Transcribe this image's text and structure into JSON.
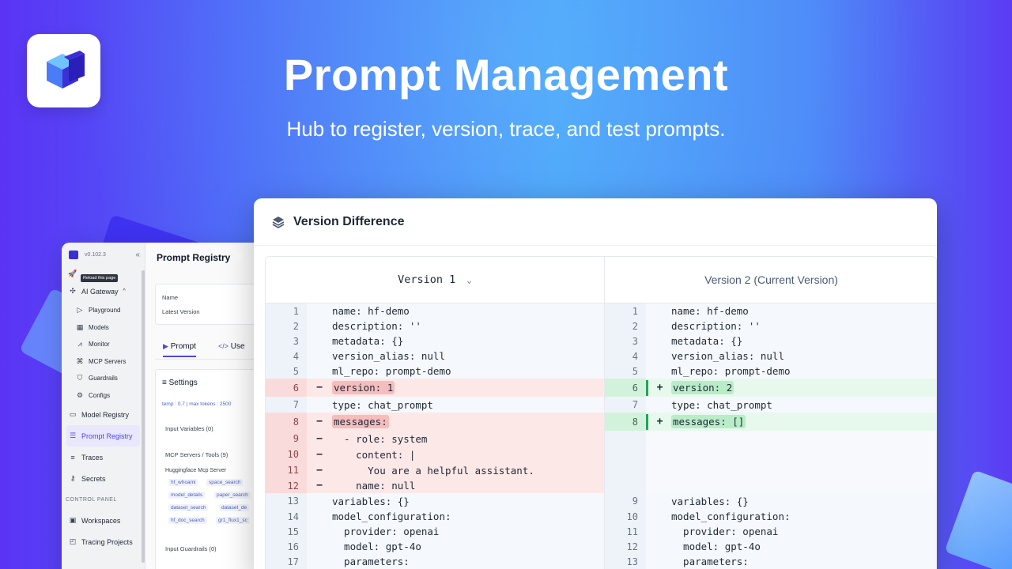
{
  "hero": {
    "title": "Prompt Management",
    "subtitle": "Hub to register, version, trace, and test prompts."
  },
  "colors": {
    "accent": "#4f46e5",
    "add": "#22a35a",
    "del": "#f7bcbc"
  },
  "back_window": {
    "version": "v0.102.3",
    "tooltip": "Reload this page",
    "sidebar": {
      "items": [
        {
          "label": "AI Gateway",
          "icon": "gateway-icon"
        },
        {
          "label": "Playground",
          "icon": "play-icon"
        },
        {
          "label": "Models",
          "icon": "grid-icon"
        },
        {
          "label": "Monitor",
          "icon": "chart-icon"
        },
        {
          "label": "MCP Servers",
          "icon": "mcp-icon"
        },
        {
          "label": "Guardrails",
          "icon": "shield-icon"
        },
        {
          "label": "Configs",
          "icon": "gear-icon"
        },
        {
          "label": "Model Registry",
          "icon": "registry-icon"
        },
        {
          "label": "Prompt Registry",
          "icon": "prompt-icon"
        },
        {
          "label": "Traces",
          "icon": "traces-icon"
        },
        {
          "label": "Secrets",
          "icon": "key-icon"
        },
        {
          "label": "Workspaces",
          "icon": "workspace-icon"
        },
        {
          "label": "Tracing Projects",
          "icon": "tracing-icon"
        }
      ],
      "section_label": "CONTROL PANEL"
    },
    "panel": {
      "title": "Prompt Registry",
      "name_label": "Name",
      "latest_label": "Latest Version",
      "tab_prompt": "Prompt",
      "tab_use": "Use",
      "settings": "Settings",
      "settings_meta": "temp : 0.7 | max tokens : 2500",
      "input_variables": "Input Variables (0)",
      "mcp_label": "MCP Servers / Tools (9)",
      "mcp_server": "Huggingface Mcp Server",
      "tools": [
        "hf_whoami",
        "space_search",
        "model_details",
        "paper_search",
        "dataset_search",
        "dataset_de",
        "hf_doc_search",
        "gr1_flux1_sc"
      ],
      "input_guardrails": "Input Guardrails (0)"
    }
  },
  "main_window": {
    "title": "Version Difference",
    "left_header": "Version 1",
    "right_header": "Version 2 (Current Version)",
    "left_rows": [
      {
        "n": "1",
        "text": "name: hf-demo",
        "type": "ctx"
      },
      {
        "n": "2",
        "text": "description: ''",
        "type": "ctx"
      },
      {
        "n": "3",
        "text": "metadata: {}",
        "type": "ctx"
      },
      {
        "n": "4",
        "text": "version_alias: null",
        "type": "ctx"
      },
      {
        "n": "5",
        "text": "ml_repo: prompt-demo",
        "type": "ctx"
      },
      {
        "n": "6",
        "text": "version: 1",
        "type": "del",
        "hl": true
      },
      {
        "n": "7",
        "text": "type: chat_prompt",
        "type": "ctx"
      },
      {
        "n": "8",
        "text": "messages:",
        "type": "del",
        "hl": true
      },
      {
        "n": "9",
        "text": "  - role: system",
        "type": "del"
      },
      {
        "n": "10",
        "text": "    content: |",
        "type": "del"
      },
      {
        "n": "11",
        "text": "      You are a helpful assistant.",
        "type": "del"
      },
      {
        "n": "12",
        "text": "    name: null",
        "type": "del"
      },
      {
        "n": "13",
        "text": "variables: {}",
        "type": "ctx"
      },
      {
        "n": "14",
        "text": "model_configuration:",
        "type": "ctx"
      },
      {
        "n": "15",
        "text": "  provider: openai",
        "type": "ctx"
      },
      {
        "n": "16",
        "text": "  model: gpt-4o",
        "type": "ctx"
      },
      {
        "n": "17",
        "text": "  parameters:",
        "type": "ctx"
      }
    ],
    "right_rows": [
      {
        "n": "1",
        "text": "name: hf-demo",
        "type": "ctx"
      },
      {
        "n": "2",
        "text": "description: ''",
        "type": "ctx"
      },
      {
        "n": "3",
        "text": "metadata: {}",
        "type": "ctx"
      },
      {
        "n": "4",
        "text": "version_alias: null",
        "type": "ctx"
      },
      {
        "n": "5",
        "text": "ml_repo: prompt-demo",
        "type": "ctx"
      },
      {
        "n": "6",
        "text": "version: 2",
        "type": "add",
        "hl": true
      },
      {
        "n": "7",
        "text": "type: chat_prompt",
        "type": "ctx"
      },
      {
        "n": "8",
        "text": "messages: []",
        "type": "add",
        "hl": true
      },
      {
        "n": "",
        "text": "",
        "type": "empty"
      },
      {
        "n": "",
        "text": "",
        "type": "empty"
      },
      {
        "n": "",
        "text": "",
        "type": "empty"
      },
      {
        "n": "",
        "text": "",
        "type": "empty"
      },
      {
        "n": "9",
        "text": "variables: {}",
        "type": "ctx"
      },
      {
        "n": "10",
        "text": "model_configuration:",
        "type": "ctx"
      },
      {
        "n": "11",
        "text": "  provider: openai",
        "type": "ctx"
      },
      {
        "n": "12",
        "text": "  model: gpt-4o",
        "type": "ctx"
      },
      {
        "n": "13",
        "text": "  parameters:",
        "type": "ctx"
      }
    ]
  }
}
